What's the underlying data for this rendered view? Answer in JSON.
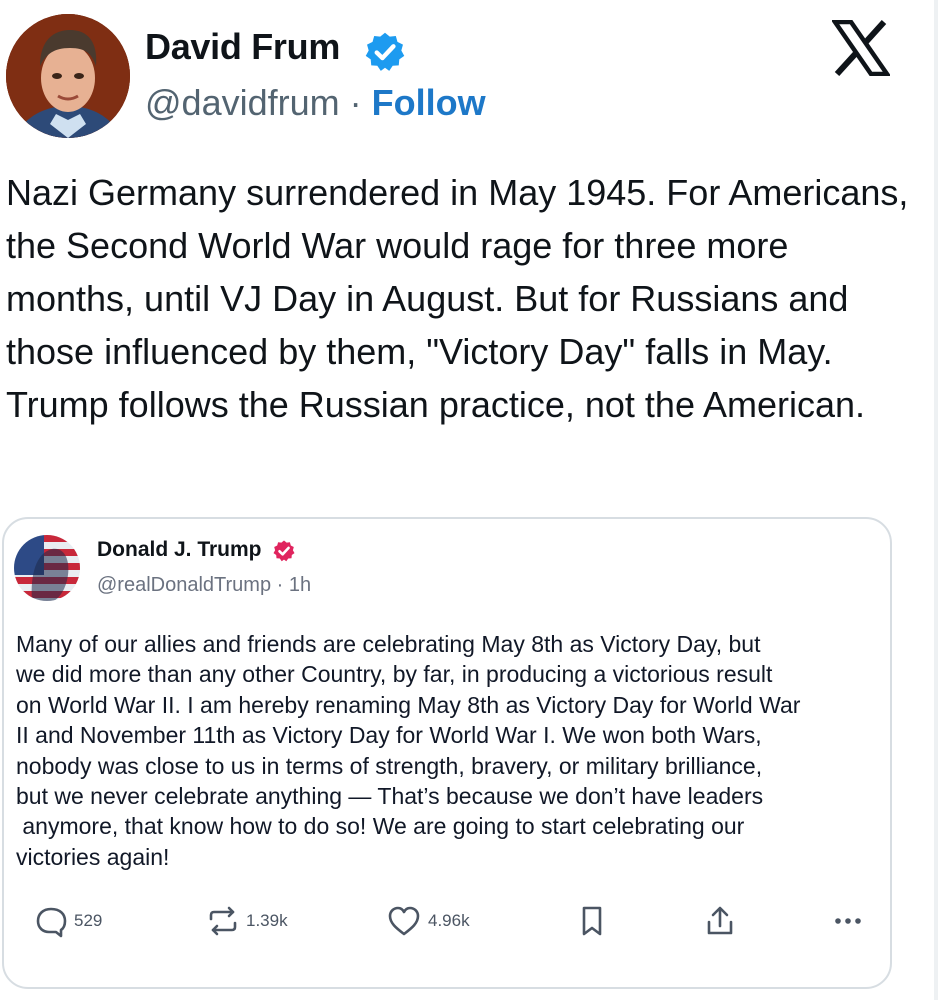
{
  "author": {
    "name": "David Frum",
    "handle": "@davidfrum",
    "separator": "·",
    "follow_label": "Follow",
    "verified_color": "#1d9bf0"
  },
  "tweet": {
    "text": "Nazi Germany surrendered in May 1945. For Americans, the Second World War would rage for three more months, until VJ Day in August. But for Russians and those influenced by them, \"Victory Day\" falls in May. Trump follows the Russian practice, not the American."
  },
  "quoted": {
    "name": "Donald J. Trump",
    "handle": "@realDonaldTrump",
    "separator": "·",
    "time": "1h",
    "badge_color": "#e0245e",
    "lines": [
      "Many of our allies and friends are celebrating May 8th as Victory Day, but",
      "we did more than any other Country, by far, in producing a victorious result",
      "on World War II. I am hereby renaming May 8th as Victory Day for World War",
      "II and November 11th as Victory Day for World War I. We won both Wars,",
      "nobody was close to us in terms of strength, bravery, or military brilliance,",
      "but we never celebrate anything — That’s because we don’t have leaders",
      " anymore, that know how to do so! We are going to start celebrating our",
      "victories again!"
    ],
    "actions": {
      "replies": "529",
      "reposts": "1.39k",
      "likes": "4.96k"
    }
  },
  "icons": {
    "platform_logo": "x-logo-icon",
    "verified": "verified-badge-icon",
    "reply": "comment-icon",
    "repost": "repost-icon",
    "like": "heart-icon",
    "bookmark": "bookmark-icon",
    "share": "share-icon",
    "more": "more-icon"
  },
  "colors": {
    "link": "#1d78c8",
    "text": "#0f1419",
    "muted": "#536471",
    "card_border": "#d7dde2"
  }
}
